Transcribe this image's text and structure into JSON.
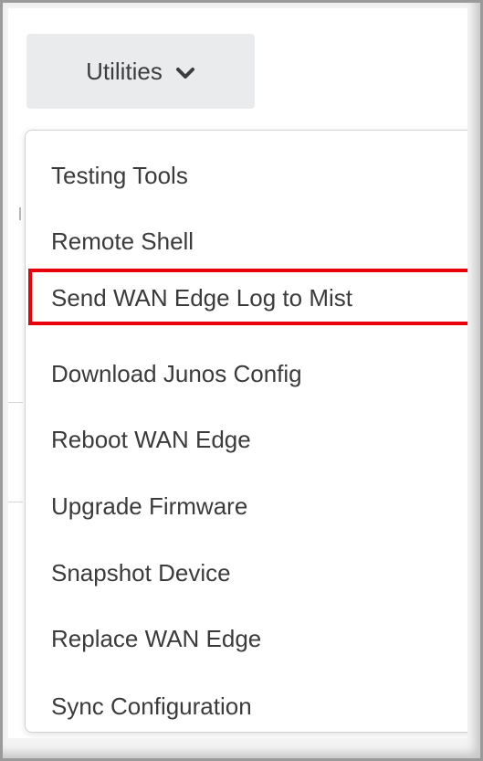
{
  "utilities_button": {
    "label": "Utilities",
    "icon": "chevron-down-icon"
  },
  "menu": {
    "items": [
      {
        "label": "Testing Tools"
      },
      {
        "label": "Remote Shell"
      },
      {
        "label": "Send WAN Edge Log to Mist"
      },
      {
        "label": "Download Junos Config"
      },
      {
        "label": "Reboot WAN Edge"
      },
      {
        "label": "Upgrade Firmware"
      },
      {
        "label": "Snapshot Device"
      },
      {
        "label": "Replace WAN Edge"
      },
      {
        "label": "Sync Configuration"
      }
    ],
    "highlighted_item": "Send WAN Edge Log to Mist"
  },
  "colors": {
    "highlight_border": "#e8000b",
    "button_bg": "#eaebec",
    "text": "#3b3b3b"
  }
}
